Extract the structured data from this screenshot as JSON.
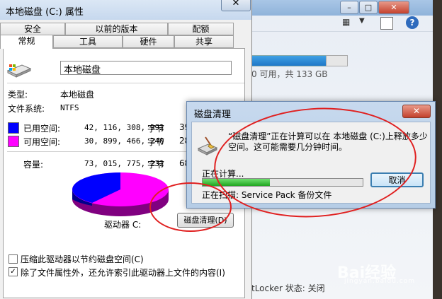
{
  "background_window": {
    "drive_free_text": "0 可用，共 133 GB",
    "drive_used_fraction": 0.78,
    "bitlocker_text": "tLocker 状态: 关闭",
    "grid_icon": "grid-view-icon",
    "dropdown_icon": "chevron-down-icon",
    "pane_icon": "preview-pane-icon",
    "help_icon": "?"
  },
  "properties": {
    "title": "本地磁盘 (C:) 属性",
    "tabs_top": [
      "安全",
      "以前的版本",
      "配额"
    ],
    "tabs_bottom": [
      "常规",
      "工具",
      "硬件",
      "共享"
    ],
    "drive_label": "本地磁盘",
    "type_label": "类型:",
    "type_value": "本地磁盘",
    "fs_label": "文件系统:",
    "fs_value": "NTFS",
    "used_label": "已用空间:",
    "used_bytes": "42, 116, 308, 992",
    "used_unit": "字节",
    "used_gb": "39",
    "free_label": "可用空间:",
    "free_bytes": "30, 899, 466, 240",
    "free_unit": "字节",
    "free_gb": "28",
    "capacity_label": "容量:",
    "capacity_bytes": "73, 015, 775, 232",
    "capacity_unit": "字节",
    "capacity_gb": "68",
    "drive_caption": "驱动器 C:",
    "cleanup_button": "磁盘清理(D)",
    "compress_label": "压缩此驱动器以节约磁盘空间(C)",
    "compress_checked": false,
    "index_label": "除了文件属性外，还允许索引此驱动器上文件的内容(I)",
    "index_checked": true,
    "used_color": "#0000ff",
    "free_color": "#ff00ff"
  },
  "cleanup_dialog": {
    "title": "磁盘清理",
    "message": "“磁盘清理”正在计算可以在 本地磁盘 (C:)上释放多少空间。这可能需要几分钟时间。",
    "calculating": "正在计算...",
    "progress": 0.42,
    "cancel": "取消",
    "scanning": "正在扫描:  Service Pack 备份文件"
  },
  "watermark": {
    "text": "Bai经验",
    "sub": "jingyan.baidu.com"
  }
}
